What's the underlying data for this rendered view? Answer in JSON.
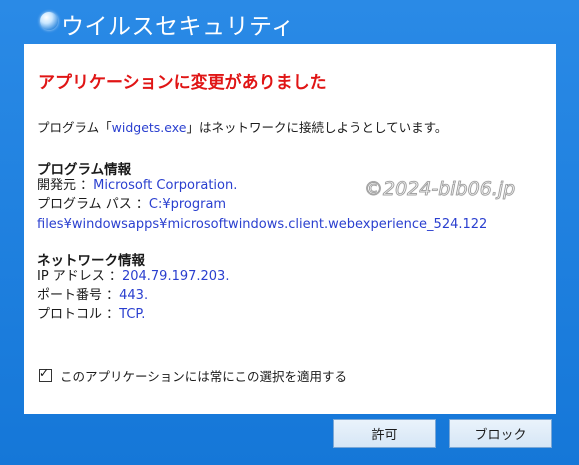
{
  "window": {
    "title": "ウイルスセキュリティ"
  },
  "alert": {
    "title": "アプリケーションに変更がありました",
    "message_prefix": "プログラム「",
    "message_program": "widgets.exe",
    "message_suffix": "」はネットワークに接続しようとしています。"
  },
  "program_info": {
    "heading": "プログラム情報",
    "developer_label": "開発元 ：",
    "developer_value": "Microsoft Corporation.",
    "path_label": "プログラム パス ：",
    "path_value_line1": "C:¥program",
    "path_value_line2": "files¥windowsapps¥microsoftwindows.client.webexperience_524.122"
  },
  "network_info": {
    "heading": "ネットワーク情報",
    "ip_label": "IP アドレス ：",
    "ip_value": "204.79.197.203.",
    "port_label": "ポート番号 ：",
    "port_value": "443.",
    "protocol_label": "プロトコル ：",
    "protocol_value": "TCP."
  },
  "option": {
    "checked": true,
    "check_mark": "✓",
    "label": "このアプリケーションには常にこの選択を適用する"
  },
  "buttons": {
    "allow": "許可",
    "block": "ブロック"
  },
  "watermark": "©2024-bib06.jp",
  "colors": {
    "frame": "#1f7fe0",
    "alert_title": "#e01515",
    "value_text": "#2a3fcf"
  }
}
